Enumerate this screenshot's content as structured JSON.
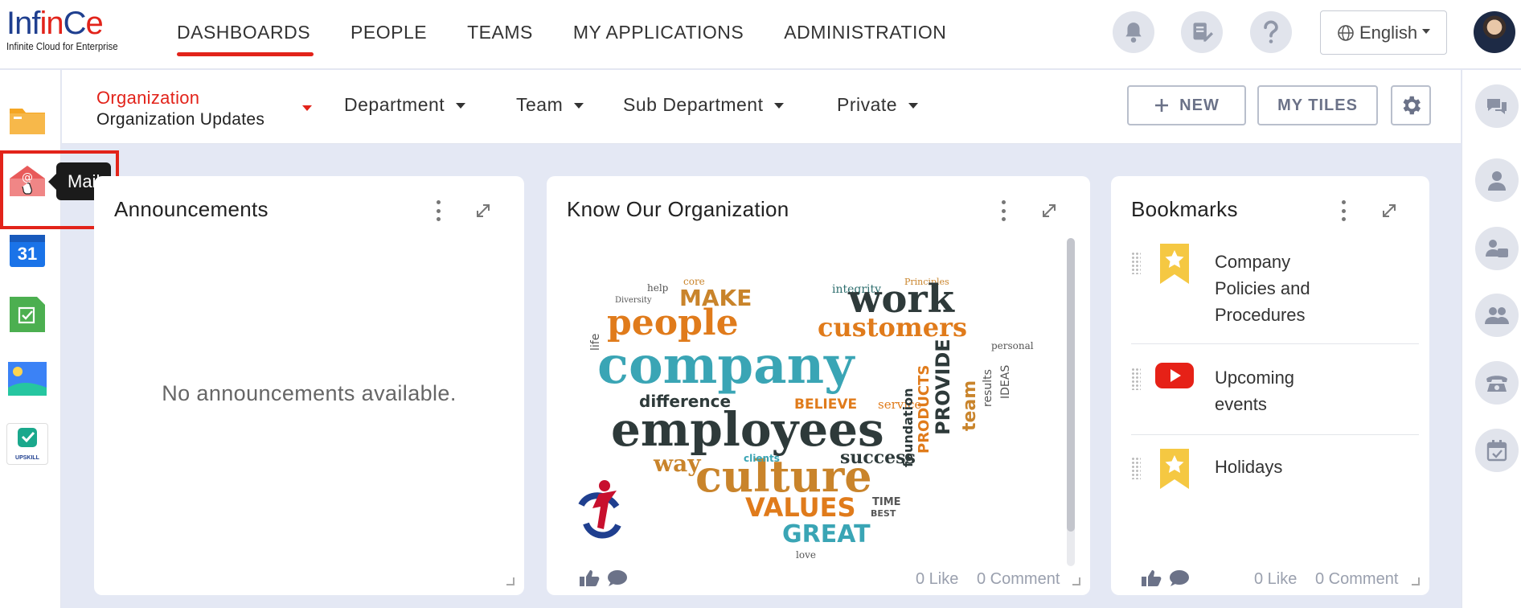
{
  "app": {
    "logo_part1": "Inf",
    "logo_part2": "in",
    "logo_part3": "C",
    "logo_part4": "e",
    "logo_tagline": "Infinite Cloud for Enterprise"
  },
  "nav": {
    "items": [
      {
        "label": "DASHBOARDS",
        "active": true
      },
      {
        "label": "PEOPLE"
      },
      {
        "label": "TEAMS"
      },
      {
        "label": "MY APPLICATIONS"
      },
      {
        "label": "ADMINISTRATION"
      }
    ],
    "language": "English"
  },
  "sidebar": {
    "tooltip": "Mail",
    "calendar_day": "31",
    "upskill_label": "UPSKILL"
  },
  "subbar": {
    "org_title": "Organization",
    "org_subtitle": "Organization Updates",
    "tabs": [
      "Department",
      "Team",
      "Sub Department",
      "Private"
    ],
    "new_label": "NEW",
    "my_tiles_label": "MY TILES"
  },
  "cards": {
    "announcements": {
      "title": "Announcements",
      "empty": "No announcements available."
    },
    "know_org": {
      "title": "Know Our Organization",
      "likes": "0 Like",
      "comments": "0 Comment",
      "cloud_words": [
        "company",
        "employees",
        "culture",
        "people",
        "work",
        "customers",
        "MAKE",
        "VALUES",
        "GREAT",
        "difference",
        "way",
        "success",
        "BELIEVE",
        "service",
        "team",
        "integrity",
        "Principles",
        "core",
        "help",
        "Diversity",
        "life",
        "personal",
        "PROVIDE",
        "TIME",
        "BEST",
        "results",
        "clients",
        "PRODUCTS",
        "IDEAS",
        "love",
        "foundation"
      ]
    },
    "bookmarks": {
      "title": "Bookmarks",
      "items": [
        "Company Policies and Procedures",
        "Upcoming events",
        "Holidays"
      ],
      "likes": "0 Like",
      "comments": "0 Comment"
    }
  },
  "colors": {
    "brand_red": "#e2231a",
    "brand_blue": "#1f3f8f",
    "bookmark_yellow": "#f5c842",
    "youtube_red": "#e62117"
  }
}
